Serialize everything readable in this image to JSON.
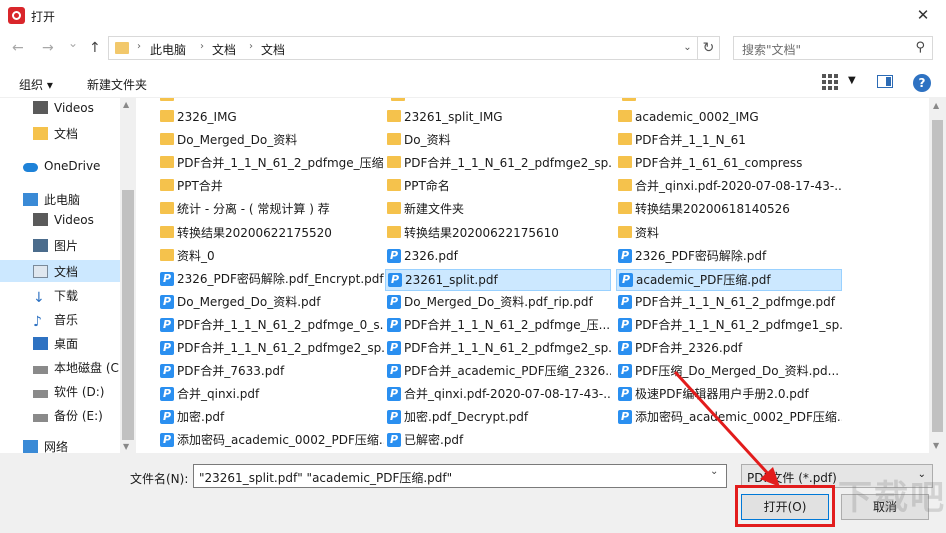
{
  "window": {
    "title": "打开",
    "close_glyph": "✕"
  },
  "nav": {
    "back_glyph": "←",
    "forward_glyph": "→",
    "recent_glyph": "⌄",
    "up_glyph": "↑",
    "breadcrumb": [
      "此电脑",
      "文档",
      "文档"
    ],
    "search_placeholder": "搜索\"文档\""
  },
  "toolbar": {
    "organize_label": "组织 ▾",
    "new_folder_label": "新建文件夹"
  },
  "sidebar": {
    "items": [
      {
        "label": "Videos",
        "icon": "video-icon"
      },
      {
        "label": "文档",
        "icon": "folder-icon"
      },
      {
        "label": "OneDrive",
        "icon": "cloud-icon"
      },
      {
        "label": "此电脑",
        "icon": "computer-icon"
      },
      {
        "label": "Videos",
        "icon": "video-icon"
      },
      {
        "label": "图片",
        "icon": "picture-icon"
      },
      {
        "label": "文档",
        "icon": "document-icon"
      },
      {
        "label": "下载",
        "icon": "download-icon"
      },
      {
        "label": "音乐",
        "icon": "music-icon"
      },
      {
        "label": "桌面",
        "icon": "desktop-icon"
      },
      {
        "label": "本地磁盘 (C",
        "icon": "drive-icon"
      },
      {
        "label": "软件 (D:)",
        "icon": "drive-icon"
      },
      {
        "label": "备份 (E:)",
        "icon": "drive-icon"
      },
      {
        "label": "网络",
        "icon": "network-icon"
      }
    ]
  },
  "files": {
    "col1": [
      {
        "name": "2326_IMG",
        "type": "folder"
      },
      {
        "name": "Do_Merged_Do_资料",
        "type": "folder"
      },
      {
        "name": "PDF合并_1_1_N_61_2_pdfmge_压缩",
        "type": "folder"
      },
      {
        "name": "PPT合并",
        "type": "folder"
      },
      {
        "name": "统计 - 分离 - ( 常规计算 ) 荐",
        "type": "folder"
      },
      {
        "name": "转换结果20200622175520",
        "type": "folder"
      },
      {
        "name": "资料_0",
        "type": "folder"
      },
      {
        "name": "2326_PDF密码解除.pdf_Encrypt.pdf",
        "type": "pdf"
      },
      {
        "name": "Do_Merged_Do_资料.pdf",
        "type": "pdf"
      },
      {
        "name": "PDF合并_1_1_N_61_2_pdfmge_0_s...",
        "type": "pdf"
      },
      {
        "name": "PDF合并_1_1_N_61_2_pdfmge2_sp...",
        "type": "pdf"
      },
      {
        "name": "PDF合并_7633.pdf",
        "type": "pdf"
      },
      {
        "name": "合并_qinxi.pdf",
        "type": "pdf"
      },
      {
        "name": "加密.pdf",
        "type": "pdf"
      },
      {
        "name": "添加密码_academic_0002_PDF压缩...",
        "type": "pdf"
      }
    ],
    "col2": [
      {
        "name": "23261_split_IMG",
        "type": "folder"
      },
      {
        "name": "Do_资料",
        "type": "folder"
      },
      {
        "name": "PDF合并_1_1_N_61_2_pdfmge2_sp...",
        "type": "folder"
      },
      {
        "name": "PPT命名",
        "type": "folder"
      },
      {
        "name": "新建文件夹",
        "type": "folder"
      },
      {
        "name": "转换结果20200622175610",
        "type": "folder"
      },
      {
        "name": "2326.pdf",
        "type": "pdf"
      },
      {
        "name": "23261_split.pdf",
        "type": "pdf",
        "selected": true
      },
      {
        "name": "Do_Merged_Do_资料.pdf_rip.pdf",
        "type": "pdf"
      },
      {
        "name": "PDF合并_1_1_N_61_2_pdfmge_压...",
        "type": "pdf"
      },
      {
        "name": "PDF合并_1_1_N_61_2_pdfmge2_sp...",
        "type": "pdf"
      },
      {
        "name": "PDF合并_academic_PDF压缩_2326...",
        "type": "pdf"
      },
      {
        "name": "合并_qinxi.pdf-2020-07-08-17-43-...",
        "type": "pdf"
      },
      {
        "name": "加密.pdf_Decrypt.pdf",
        "type": "pdf"
      },
      {
        "name": "已解密.pdf",
        "type": "pdf"
      }
    ],
    "col3": [
      {
        "name": "academic_0002_IMG",
        "type": "folder"
      },
      {
        "name": "PDF合并_1_1_N_61",
        "type": "folder"
      },
      {
        "name": "PDF合并_1_61_61_compress",
        "type": "folder"
      },
      {
        "name": "合并_qinxi.pdf-2020-07-08-17-43-...",
        "type": "folder"
      },
      {
        "name": "转换结果20200618140526",
        "type": "folder"
      },
      {
        "name": "资料",
        "type": "folder"
      },
      {
        "name": "2326_PDF密码解除.pdf",
        "type": "pdf"
      },
      {
        "name": "academic_PDF压缩.pdf",
        "type": "pdf",
        "selected": true
      },
      {
        "name": "PDF合并_1_1_N_61_2_pdfmge.pdf",
        "type": "pdf"
      },
      {
        "name": "PDF合并_1_1_N_61_2_pdfmge1_sp...",
        "type": "pdf"
      },
      {
        "name": "PDF合并_2326.pdf",
        "type": "pdf"
      },
      {
        "name": "PDF压缩_Do_Merged_Do_资料.pd...",
        "type": "pdf"
      },
      {
        "name": "极速PDF编辑器用户手册2.0.pdf",
        "type": "pdf"
      },
      {
        "name": "添加密码_academic_0002_PDF压缩...",
        "type": "pdf"
      }
    ]
  },
  "footer": {
    "filename_label": "文件名(N):",
    "filename_value": "\"23261_split.pdf\" \"academic_PDF压缩.pdf\"",
    "filetype_value": "PDF文件 (*.pdf)",
    "open_label": "打开(O)",
    "cancel_label": "取消"
  },
  "watermark": "下载吧",
  "colors": {
    "highlight": "#e21c1c",
    "selection": "#cce8ff",
    "accent": "#0078d7"
  }
}
